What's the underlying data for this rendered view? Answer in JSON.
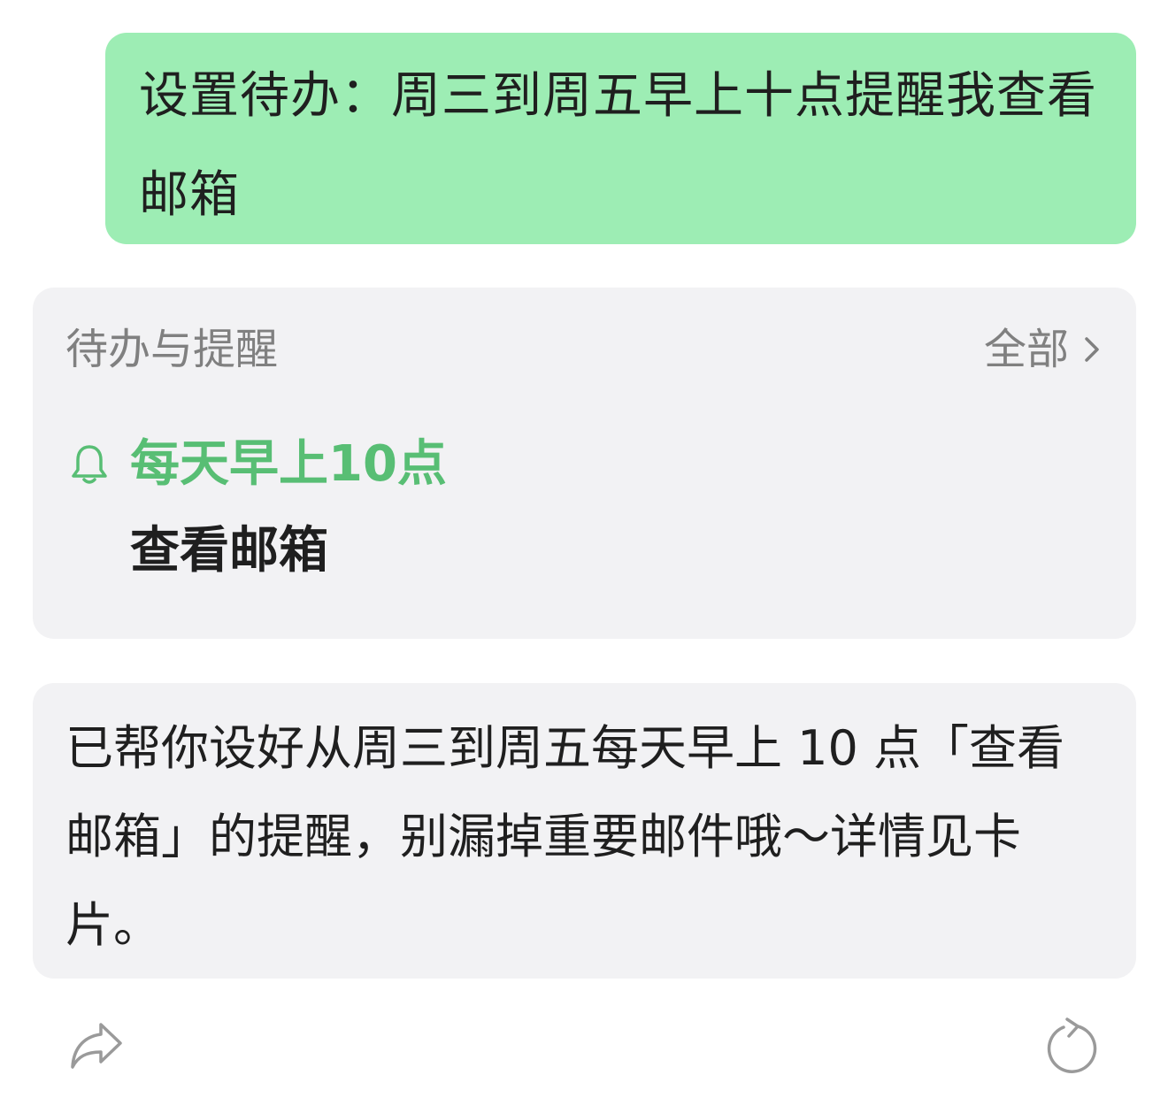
{
  "user_message": {
    "text": "设置待办：周三到周五早上十点提醒我查看邮箱"
  },
  "todo_card": {
    "title": "待办与提醒",
    "all_label": "全部",
    "chevron_icon": "chevron-right-icon",
    "reminder": {
      "icon": "bell-icon",
      "time": "每天早上10点",
      "task": "查看邮箱"
    },
    "accent_color": "#58BE74"
  },
  "assistant_message": {
    "text": "已帮你设好从周三到周五每天早上 10 点「查看邮箱」的提醒，别漏掉重要邮件哦～详情见卡片。"
  },
  "actions": {
    "share_icon": "share-icon",
    "regenerate_icon": "regenerate-icon"
  },
  "colors": {
    "user_bubble": "#9DEDB4",
    "card_background": "#F2F2F4",
    "secondary_text": "#808080",
    "primary_text": "#1f1f1f"
  }
}
